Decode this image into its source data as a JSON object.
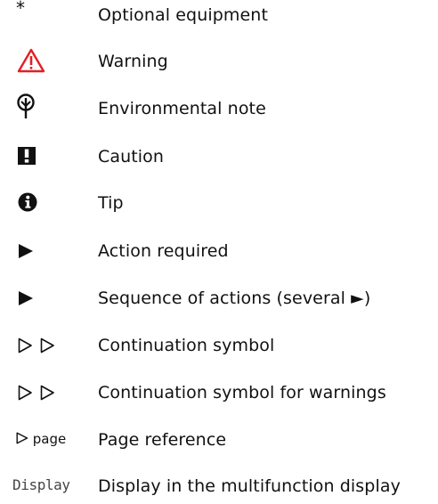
{
  "legend": {
    "items": [
      {
        "symbol": "*",
        "icon": "asterisk-icon",
        "label": "Optional equipment"
      },
      {
        "icon": "warning-triangle-icon",
        "label": "Warning"
      },
      {
        "icon": "environment-leaf-icon",
        "label": "Environmental note"
      },
      {
        "icon": "caution-exclamation-icon",
        "label": "Caution"
      },
      {
        "icon": "info-i-icon",
        "label": "Tip"
      },
      {
        "icon": "action-arrow-icon",
        "label": "Action required"
      },
      {
        "icon": "action-arrow-icon",
        "label": "Sequence of actions (several ►)"
      },
      {
        "icon": "continuation-triangles-icon",
        "label": "Continuation symbol"
      },
      {
        "icon": "continuation-triangles-icon",
        "label": "Continuation symbol for warnings"
      },
      {
        "symbol": "page",
        "icon": "page-reference-triangle-icon",
        "label": "Page reference"
      },
      {
        "symbol": "Display",
        "label": "Display in the multifunction display"
      }
    ]
  },
  "colors": {
    "warning_red": "#e31e24",
    "text": "#111111",
    "display_text": "#444444"
  }
}
